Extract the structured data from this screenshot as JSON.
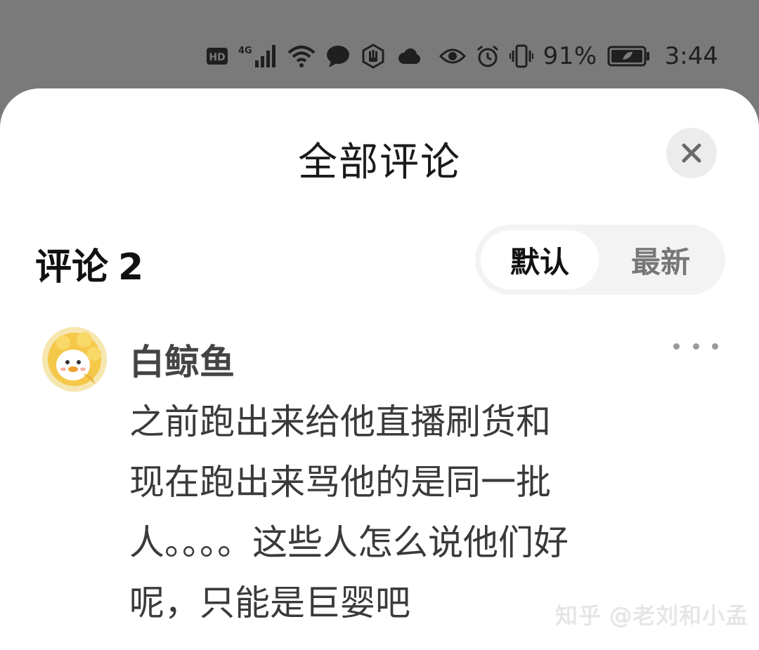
{
  "status_bar": {
    "battery_percent": "91%",
    "time": "3:44",
    "icons": [
      "hd-icon",
      "4g-signal-icon",
      "wifi-icon",
      "message-icon",
      "hand-icon",
      "cloud-icon",
      "eye-icon",
      "alarm-icon",
      "vibrate-icon",
      "battery-icon"
    ]
  },
  "sheet": {
    "title": "全部评论",
    "close_icon": "close-icon"
  },
  "comments_header": {
    "label": "评论",
    "count": "2",
    "sort_options": [
      {
        "label": "默认",
        "active": true
      },
      {
        "label": "最新",
        "active": false
      }
    ]
  },
  "comment": {
    "username": "白鲸鱼",
    "text": "之前跑出来给他直播刷货和\n现在跑出来骂他的是同一批\n人。。。。这些人怎么说他们好\n呢，只能是巨婴吧"
  },
  "watermark": "知乎 @老刘和小孟"
}
